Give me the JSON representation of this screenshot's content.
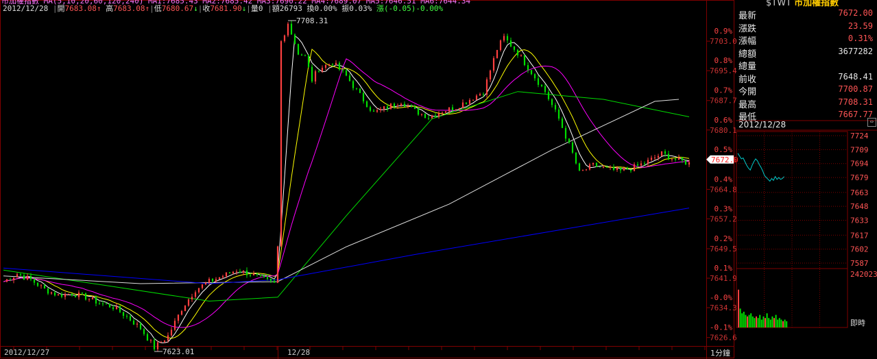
{
  "header": {
    "line1": "市加權指數 MA(5,10,20,60,120,240) MA1:7685.43 MA2:7685.42 MA3:7690.22 MA4:7689.07 MA5:7646.51 MA6:7644.34",
    "date": "2012/12/28",
    "open_label": "開",
    "open": "7683.08",
    "high_label": "高",
    "high": "7683.08",
    "low_label": "低",
    "low": "7680.67",
    "close_label": "收",
    "close": "7681.90",
    "vol": "量0",
    "amt": "額26793",
    "turnover": "換0.00%",
    "amplitude": "振0.03%",
    "change": "漲(-0.05)-0.00%"
  },
  "quote": {
    "symbol": "$TWT",
    "name": "市加權指數",
    "rows": [
      {
        "label": "最新",
        "value": "7672.00",
        "color": "#ff5555"
      },
      {
        "label": "漲跌",
        "value": "23.59",
        "color": "#ff5555"
      },
      {
        "label": "漲幅",
        "value": "0.31%",
        "color": "#ff5555"
      },
      {
        "label": "總額",
        "value": "3677282",
        "color": "#e8e8e8"
      },
      {
        "label": "總量",
        "value": "",
        "color": "#e8e8e8"
      },
      {
        "label": "前收",
        "value": "7648.41",
        "color": "#e8e8e8"
      },
      {
        "label": "今開",
        "value": "7700.87",
        "color": "#ff5555"
      },
      {
        "label": "最高",
        "value": "7708.31",
        "color": "#ff5555"
      },
      {
        "label": "最低",
        "value": "7667.77",
        "color": "#ff5555"
      }
    ],
    "mini_date": "2012/12/28",
    "mini_vol_label": "242023",
    "mini_time_label": "即時"
  },
  "colors": {
    "up": "#ff4040",
    "down": "#00e000",
    "grid": "#800000",
    "ma5": "#ffffff",
    "ma10": "#ffff00",
    "ma20": "#ff00ff",
    "ma60": "#00dd00",
    "ma120": "#dddddd",
    "ma240": "#0000ff",
    "axis_text": "#cc3333",
    "pct_text": "#ff4444"
  },
  "chart_data": [
    {
      "type": "candlestick",
      "interval": "1分鐘",
      "x_labels": [
        "2012/12/27",
        "12/28",
        "1分鐘"
      ],
      "y_ticks": [
        7703.0,
        7695.4,
        7687.7,
        7680.1,
        7672.5,
        7664.8,
        7657.2,
        7649.5,
        7641.9,
        7634.3,
        7626.6
      ],
      "pct_ticks": [
        "0.9%",
        "0.8%",
        "0.7%",
        "0.6%",
        "0.5%",
        "0.4%",
        "0.3%",
        "0.2%",
        "0.1%",
        "-0.0%",
        "-0.1%"
      ],
      "ylim": [
        7624.6,
        7711.5
      ],
      "current_price_label": "7672.0",
      "annotations": [
        {
          "text": "7708.31",
          "x": 83,
          "y": 7708.31
        },
        {
          "text": "7623.01",
          "x": 44,
          "y": 7623.01
        }
      ],
      "keypoints": [
        [
          0,
          7641.0
        ],
        [
          4,
          7643.0
        ],
        [
          8,
          7641.5
        ],
        [
          12,
          7639.0
        ],
        [
          16,
          7637.5
        ],
        [
          20,
          7638.0
        ],
        [
          24,
          7637.0
        ],
        [
          28,
          7635.5
        ],
        [
          32,
          7634.5
        ],
        [
          36,
          7632.0
        ],
        [
          40,
          7629.0
        ],
        [
          44,
          7624.0
        ],
        [
          48,
          7627.0
        ],
        [
          52,
          7634.0
        ],
        [
          56,
          7639.0
        ],
        [
          60,
          7641.0
        ],
        [
          64,
          7642.5
        ],
        [
          68,
          7644.0
        ],
        [
          72,
          7643.0
        ],
        [
          76,
          7641.5
        ],
        [
          79,
          7640.5
        ],
        [
          80,
          7650.0
        ],
        [
          81,
          7703.0
        ],
        [
          83,
          7707.5
        ],
        [
          86,
          7700.0
        ],
        [
          88,
          7699.0
        ],
        [
          90,
          7693.0
        ],
        [
          92,
          7696.0
        ],
        [
          96,
          7697.5
        ],
        [
          100,
          7694.0
        ],
        [
          104,
          7689.0
        ],
        [
          108,
          7684.5
        ],
        [
          112,
          7686.0
        ],
        [
          116,
          7687.5
        ],
        [
          120,
          7685.0
        ],
        [
          124,
          7683.5
        ],
        [
          128,
          7685.0
        ],
        [
          132,
          7686.0
        ],
        [
          136,
          7688.0
        ],
        [
          140,
          7690.0
        ],
        [
          144,
          7701.0
        ],
        [
          146,
          7704.0
        ],
        [
          150,
          7700.0
        ],
        [
          154,
          7695.0
        ],
        [
          158,
          7690.0
        ],
        [
          162,
          7683.0
        ],
        [
          166,
          7674.0
        ],
        [
          168,
          7669.0
        ],
        [
          172,
          7671.0
        ],
        [
          176,
          7670.0
        ],
        [
          180,
          7669.5
        ],
        [
          184,
          7670.5
        ],
        [
          188,
          7672.0
        ],
        [
          192,
          7674.0
        ],
        [
          196,
          7672.5
        ],
        [
          200,
          7671.5
        ]
      ],
      "moving_averages": [
        {
          "name": "MA60",
          "points": [
            [
              0,
              7644.0
            ],
            [
              30,
              7640.0
            ],
            [
              60,
              7636.0
            ],
            [
              80,
              7637.0
            ],
            [
              100,
              7658.0
            ],
            [
              125,
              7683.0
            ],
            [
              150,
              7690.0
            ],
            [
              175,
              7688.0
            ],
            [
              200,
              7683.5
            ]
          ]
        },
        {
          "name": "MA120",
          "points": [
            [
              0,
              7642.5
            ],
            [
              40,
              7640.5
            ],
            [
              80,
              7641.0
            ],
            [
              100,
              7650.0
            ],
            [
              130,
              7661.0
            ],
            [
              160,
              7675.0
            ],
            [
              190,
              7687.5
            ],
            [
              197,
              7688.0
            ]
          ]
        },
        {
          "name": "MA240",
          "points": [
            [
              0,
              7644.5
            ],
            [
              60,
              7640.5
            ],
            [
              80,
              7641.5
            ],
            [
              120,
              7648.0
            ],
            [
              160,
              7654.0
            ],
            [
              200,
              7660.0
            ]
          ]
        }
      ]
    },
    {
      "type": "line",
      "title": "2012/12/28",
      "y_ticks": [
        7724,
        7709,
        7694,
        7679,
        7663,
        7648,
        7633,
        7617,
        7602,
        7587
      ],
      "values": [
        7705,
        7702,
        7699,
        7700,
        7696,
        7692,
        7689,
        7687,
        7692,
        7696,
        7699,
        7697,
        7693,
        7690,
        7686,
        7681,
        7679,
        7677,
        7675,
        7678,
        7676,
        7680,
        7677,
        7679,
        7677,
        7678,
        7680
      ]
    },
    {
      "type": "bar",
      "label": "242023",
      "values": [
        24,
        12,
        9,
        10,
        8,
        7,
        8,
        9,
        7,
        6,
        7,
        6,
        8,
        5,
        7,
        6,
        9,
        6,
        5,
        7,
        6,
        8,
        5,
        6,
        5,
        4,
        5,
        4
      ]
    }
  ]
}
